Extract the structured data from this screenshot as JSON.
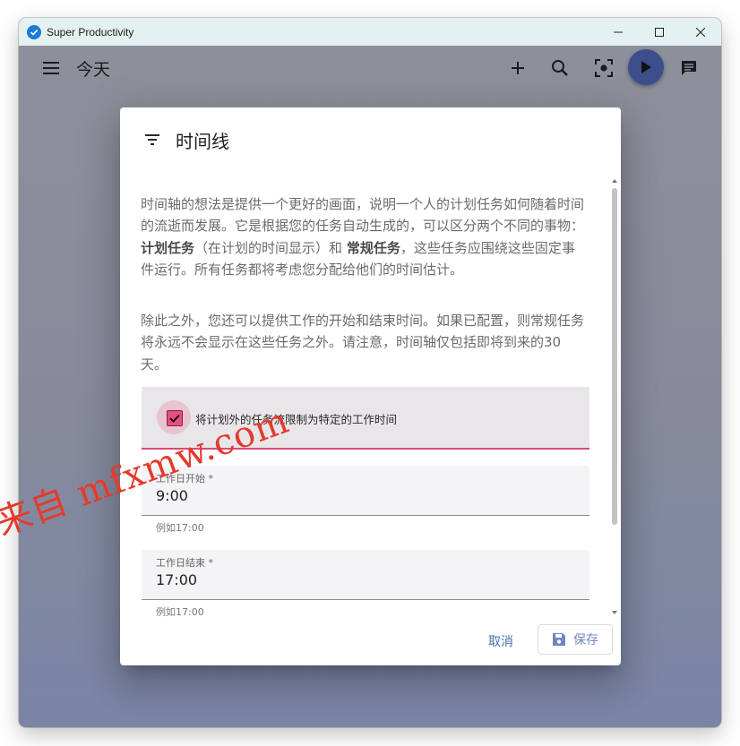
{
  "window": {
    "title": "Super Productivity"
  },
  "toolbar": {
    "page_title": "今天"
  },
  "dialog": {
    "title": "时间线",
    "para1": {
      "text1": "时间轴的想法是提供一个更好的画面，说明一个人的计划任务如何随着时间的流逝而发展。它是根据您的任务自动生成的，可以区分两个不同的事物：",
      "bold1": "计划任务",
      "text2": "（在计划的时间显示）和",
      "bold2": "常规任务",
      "text3": "，这些任务应围绕这些固定事件运行。所有任务都将考虑您分配给他们的时间估计。"
    },
    "para2": "除此之外，您还可以提供工作的开始和结束时间。如果已配置，则常规任务将永远不会显示在这些任务之外。请注意，时间轴仅包括即将到来的30天。",
    "checkbox": {
      "label": "将计划外的任务流限制为特定的工作时间",
      "checked": true
    },
    "start_field": {
      "label": "工作日开始 *",
      "value": "9:00",
      "hint": "例如17:00"
    },
    "end_field": {
      "label": "工作日结束 *",
      "value": "17:00",
      "hint": "例如17:00"
    },
    "actions": {
      "cancel": "取消",
      "save": "保存"
    }
  },
  "watermark": "来自 mfxmw.com",
  "colors": {
    "accent": "#e35082",
    "primary": "#3c4f8c",
    "link": "#4a6fb0",
    "titlebar": "#e4f1f1"
  },
  "icons": [
    "app-icon",
    "minimize-icon",
    "maximize-icon",
    "close-icon",
    "menu-icon",
    "add-icon",
    "search-icon",
    "focus-icon",
    "play-icon",
    "notes-icon",
    "filter-icon",
    "check-icon",
    "save-icon"
  ]
}
